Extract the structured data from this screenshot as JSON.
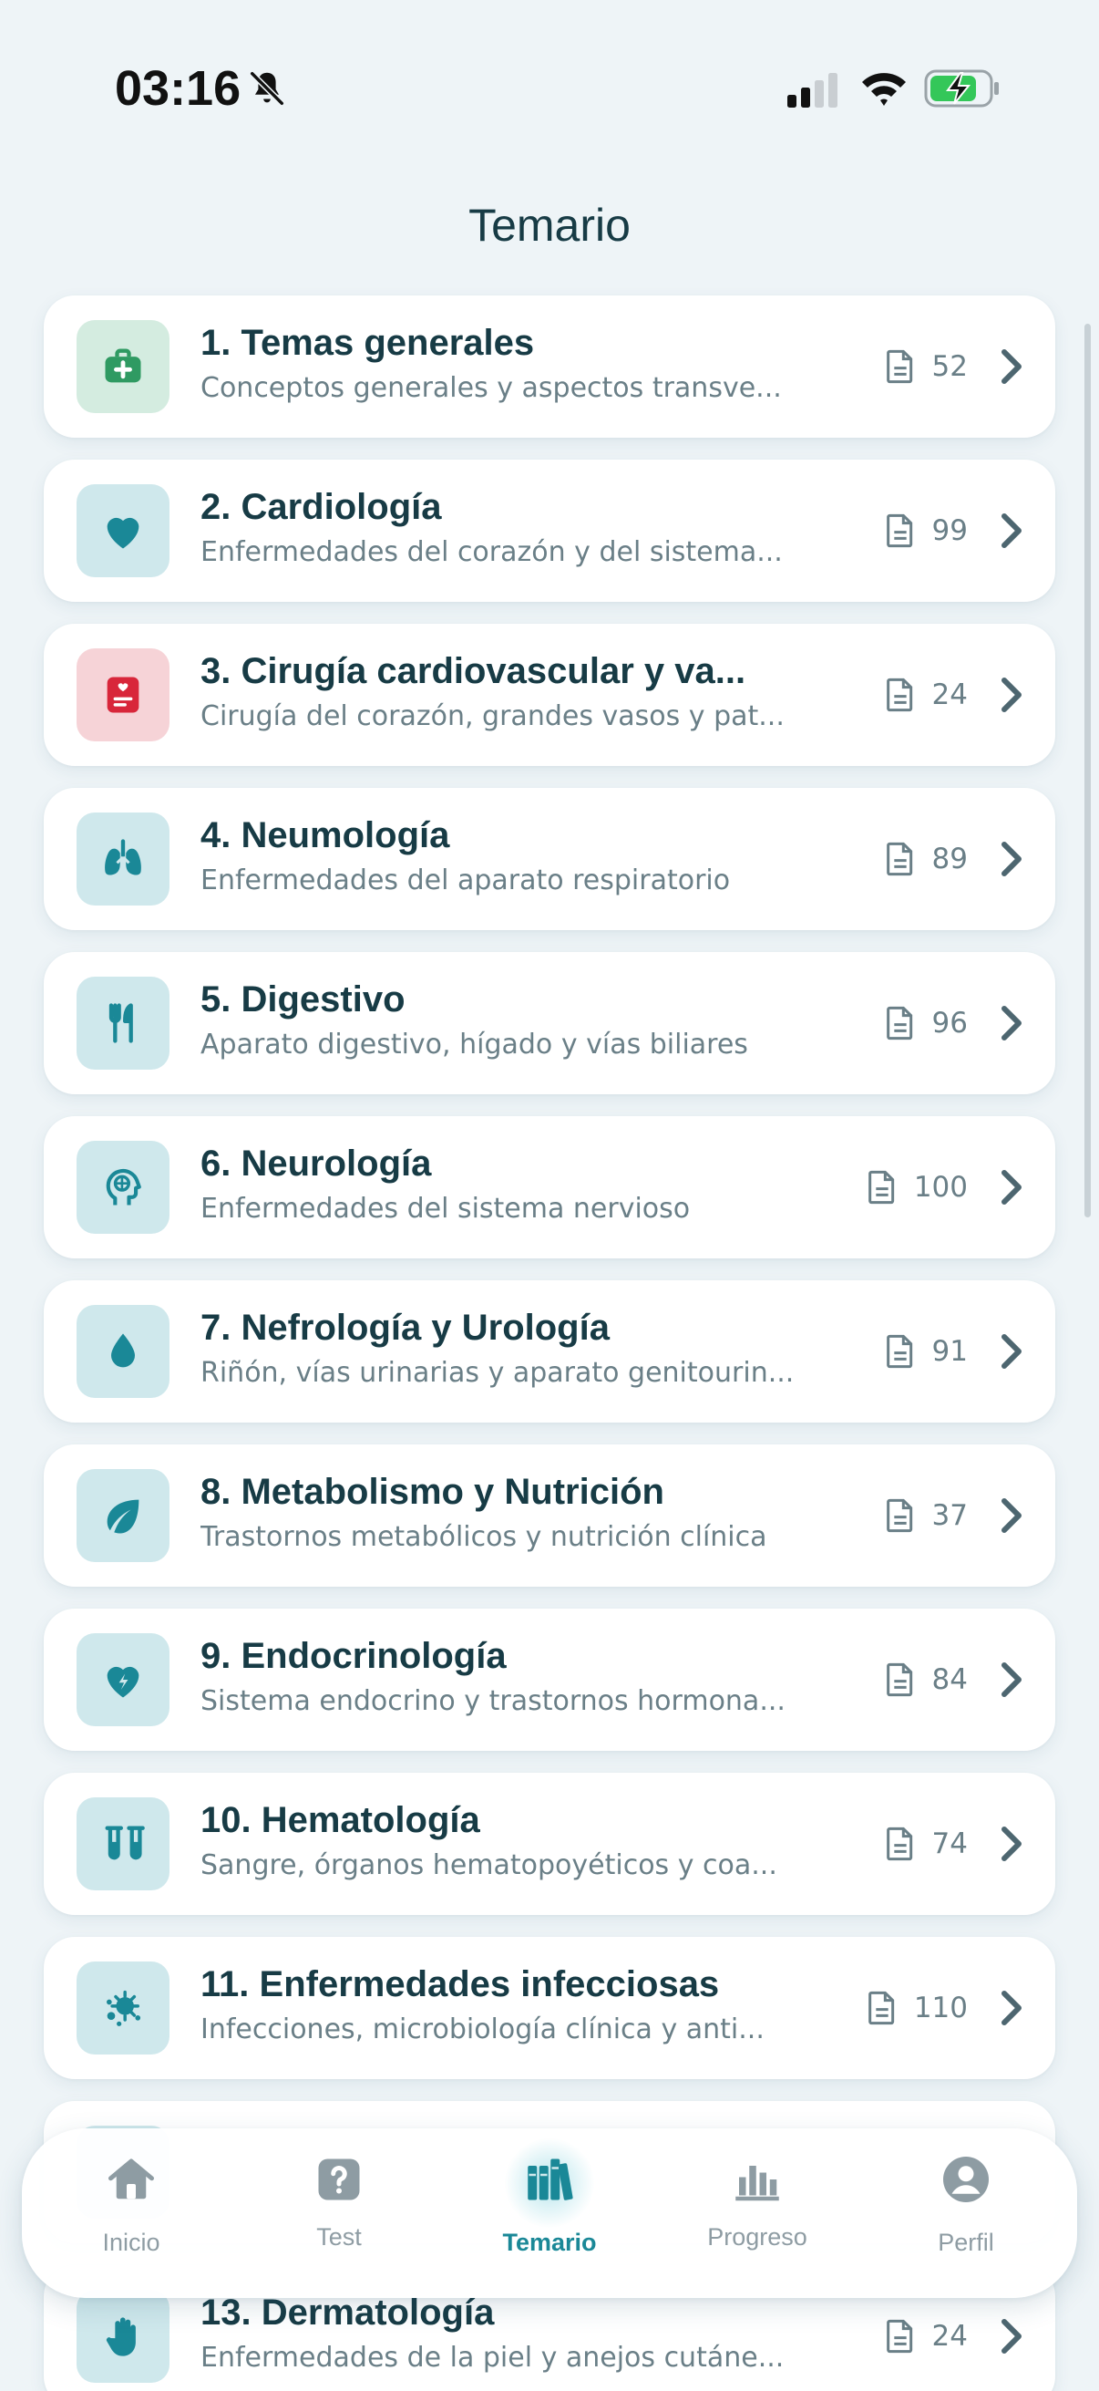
{
  "status_bar": {
    "time": "03:16"
  },
  "header": {
    "title": "Temario"
  },
  "topics": [
    {
      "title": "1. Temas generales",
      "subtitle": "Conceptos generales y aspectos transve...",
      "count": "52",
      "icon": "medical-kit-icon",
      "icon_bg": "#d4ece0",
      "icon_color": "#2f9a62"
    },
    {
      "title": "2. Cardiología",
      "subtitle": "Enfermedades del corazón y del sistema...",
      "count": "99",
      "icon": "heart-icon",
      "icon_bg": "#cfe8ec",
      "icon_color": "#1a8897"
    },
    {
      "title": "3. Cirugía cardiovascular y va...",
      "subtitle": "Cirugía del corazón, grandes vasos y pat...",
      "count": "24",
      "icon": "medical-record-icon",
      "icon_bg": "#f6d3d7",
      "icon_color": "#d8263a"
    },
    {
      "title": "4. Neumología",
      "subtitle": "Enfermedades del aparato respiratorio",
      "count": "89",
      "icon": "lungs-icon",
      "icon_bg": "#cfe8ec",
      "icon_color": "#1a8897"
    },
    {
      "title": "5. Digestivo",
      "subtitle": "Aparato digestivo, hígado y vías biliares",
      "count": "96",
      "icon": "utensils-icon",
      "icon_bg": "#cfe8ec",
      "icon_color": "#1a8897"
    },
    {
      "title": "6. Neurología",
      "subtitle": "Enfermedades del sistema nervioso",
      "count": "100",
      "icon": "brain-head-icon",
      "icon_bg": "#cfe8ec",
      "icon_color": "#1a8897"
    },
    {
      "title": "7. Nefrología y Urología",
      "subtitle": "Riñón, vías urinarias y aparato genitourin...",
      "count": "91",
      "icon": "drop-icon",
      "icon_bg": "#cfe8ec",
      "icon_color": "#1a8897"
    },
    {
      "title": "8. Metabolismo y Nutrición",
      "subtitle": "Trastornos metabólicos y nutrición clínica",
      "count": "37",
      "icon": "leaf-icon",
      "icon_bg": "#cfe8ec",
      "icon_color": "#1a8897"
    },
    {
      "title": "9. Endocrinología",
      "subtitle": "Sistema endocrino y trastornos hormona...",
      "count": "84",
      "icon": "heart-bolt-icon",
      "icon_bg": "#cfe8ec",
      "icon_color": "#1a8897"
    },
    {
      "title": "10. Hematología",
      "subtitle": "Sangre, órganos hematopoyéticos y coa...",
      "count": "74",
      "icon": "test-tubes-icon",
      "icon_bg": "#cfe8ec",
      "icon_color": "#1a8897"
    },
    {
      "title": "11. Enfermedades infecciosas",
      "subtitle": "Infecciones, microbiología clínica y anti...",
      "count": "110",
      "icon": "virus-icon",
      "icon_bg": "#cfe8ec",
      "icon_color": "#1a8897"
    },
    {
      "title": "",
      "subtitle": "",
      "count": "",
      "icon": "",
      "icon_bg": "#cfe8ec",
      "icon_color": "#1a8897"
    },
    {
      "title": "13. Dermatología",
      "subtitle": "Enfermedades de la piel y anejos cutáne...",
      "count": "24",
      "icon": "hand-icon",
      "icon_bg": "#cfe8ec",
      "icon_color": "#1a8897"
    }
  ],
  "nav": [
    {
      "label": "Inicio",
      "icon": "home-icon",
      "active": false
    },
    {
      "label": "Test",
      "icon": "question-icon",
      "active": false
    },
    {
      "label": "Temario",
      "icon": "books-icon",
      "active": true
    },
    {
      "label": "Progreso",
      "icon": "bar-chart-icon",
      "active": false
    },
    {
      "label": "Perfil",
      "icon": "user-icon",
      "active": false
    }
  ],
  "colors": {
    "accent": "#1a8897",
    "text": "#173b45",
    "muted": "#6a7f87",
    "nav_inactive": "#8e9ca3",
    "background": "#eef4f7"
  }
}
